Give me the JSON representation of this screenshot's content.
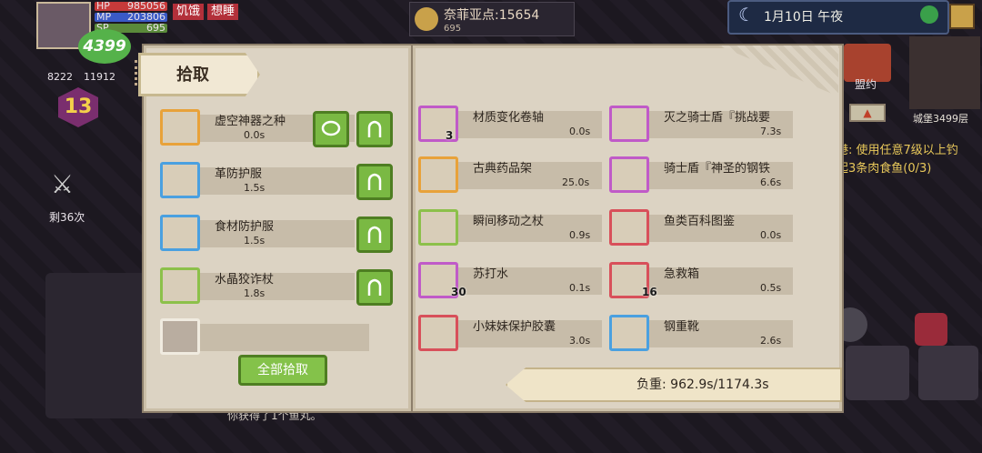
{
  "hud": {
    "hp_label": "HP",
    "hp_value": "985056",
    "mp_label": "MP",
    "mp_value": "203806",
    "sp_label": "SP",
    "sp_value": "695",
    "coins": "4399",
    "status_hungry": "饥饿",
    "status_sleepy": "想睡",
    "stat1": "8222",
    "stat2": "11912",
    "level": "13",
    "kills": "剩36次",
    "gold": "奈菲亚点:15654",
    "gold_sub": "695",
    "date": "1月10日 午夜",
    "alliance": "盟约",
    "map_label": "城堡3499层",
    "quest_line1": "港: 使用任意7级以上钓",
    "quest_line2": "起3条肉食鱼(0/3)",
    "log": "你获得了1个鱼丸。"
  },
  "pickup_panel": {
    "title": "拾取",
    "items": [
      {
        "name": "虚空神器之种",
        "time": "0.0s"
      },
      {
        "name": "革防护服",
        "time": "1.5s"
      },
      {
        "name": "食材防护服",
        "time": "1.5s"
      },
      {
        "name": "水晶狡诈杖",
        "time": "1.8s"
      }
    ],
    "pick_all": "全部拾取"
  },
  "inventory_panel": {
    "items_left": [
      {
        "name": "材质变化卷轴",
        "time": "0.0s",
        "qty": "3"
      },
      {
        "name": "古典药品架",
        "time": "25.0s",
        "qty": ""
      },
      {
        "name": "瞬间移动之杖",
        "time": "0.9s",
        "qty": ""
      },
      {
        "name": "苏打水",
        "time": "0.1s",
        "qty": "30"
      },
      {
        "name": "小妹妹保护胶囊",
        "time": "3.0s",
        "qty": ""
      }
    ],
    "items_right": [
      {
        "name": "灭之骑士盾『挑战要",
        "time": "7.3s",
        "qty": ""
      },
      {
        "name": "骑士盾『神圣的钢铁",
        "time": "6.6s",
        "qty": ""
      },
      {
        "name": "鱼类百科图鉴",
        "time": "0.0s",
        "qty": ""
      },
      {
        "name": "急救箱",
        "time": "0.5s",
        "qty": "16"
      },
      {
        "name": "钢重靴",
        "time": "2.6s",
        "qty": ""
      }
    ],
    "weight": "负重: 962.9s/1174.3s"
  },
  "colors": {
    "panel_bg": "#dcd3c3",
    "accent_green": "#7ab943",
    "border_orange": "#e8a23a",
    "border_blue": "#4aa0e0",
    "border_purple": "#c05ac8",
    "border_red": "#d8505a",
    "border_green": "#8cc04a"
  }
}
